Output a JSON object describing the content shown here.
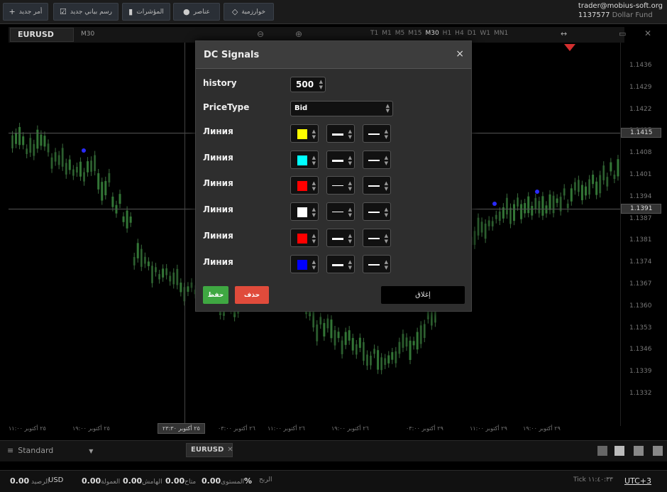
{
  "toolbar": {
    "buttons": [
      {
        "label": "أمر جديد",
        "icon": "+"
      },
      {
        "label": "رسم بياني جديد",
        "icon": "☑"
      },
      {
        "label": "المؤشرات",
        "icon": "▮"
      },
      {
        "label": "عناصر",
        "icon": "●"
      },
      {
        "label": "خوارزمية",
        "icon": "◇"
      }
    ]
  },
  "account": {
    "email": "trader@mobius-soft.org",
    "number": "1137577",
    "fund": "Dollar Fund"
  },
  "chart": {
    "symbol": "EURUSD",
    "period": "M30",
    "timeframes": [
      "T1",
      "M1",
      "M5",
      "M15",
      "M30",
      "H1",
      "H4",
      "D1",
      "W1",
      "MN1"
    ],
    "active_timeframe": "M30",
    "price_labels": [
      "1.1436",
      "1.1429",
      "1.1422",
      "1.1415",
      "1.1408",
      "1.1401",
      "1.1394",
      "1.1387",
      "1.1381",
      "1.1374",
      "1.1367",
      "1.1360",
      "1.1353",
      "1.1346",
      "1.1339",
      "1.1332"
    ],
    "price_tags": [
      "1.1415",
      "1.1391"
    ],
    "time_labels": [
      "٢٥ أكتوبر ١١:٠٠",
      "٢٥ أكتوبر ١٩:٠٠",
      "٢٥ أكتوبر ٢٣:٣٠",
      "٢٦ أكتوبر ٠٣:٠٠",
      "٢٦ أكتوبر ١١:٠٠",
      "٢٦ أكتوبر ١٩:٠٠",
      "٢٩ أكتوبر ٠٣:٠٠",
      "٢٩ أكتوبر ١١:٠٠",
      "٢٩ أكتوبر ١٩:٠٠"
    ],
    "colors": {
      "bull": "#2e7d32",
      "bear": "#1f4f22",
      "marker": "#2a2aff",
      "arrow": "#d32f2f"
    }
  },
  "dialog": {
    "title": "DC Signals",
    "close_icon": "×",
    "history_label": "history",
    "history_value": "500",
    "price_type_label": "PriceType",
    "price_type_value": "Bid",
    "lines": [
      {
        "label": "Линия",
        "color": "#ffff00",
        "thick": true
      },
      {
        "label": "Линия",
        "color": "#00ffff",
        "thick": true
      },
      {
        "label": "Линия",
        "color": "#ff0000",
        "thick": false
      },
      {
        "label": "Линия",
        "color": "#ffffff",
        "thick": false
      },
      {
        "label": "Линия",
        "color": "#ff0000",
        "thick": true
      },
      {
        "label": "Линия",
        "color": "#0000ff",
        "thick": true
      }
    ],
    "save_label": "حفظ",
    "delete_label": "حذف",
    "close_label": "إغلاق"
  },
  "bottom": {
    "layout": "Standard",
    "tab": "EURUSD"
  },
  "status": {
    "balance_value": "0.00",
    "currency": "USD",
    "equity_value": "0.00",
    "margin_value": "0.00",
    "free_value": "0.00",
    "level_value": "0.00",
    "percent": "%",
    "tick_label": "Tick",
    "time": "١١:٤٠:٣٣",
    "timezone": "UTC+3",
    "labels": {
      "balance": "الرصيد",
      "equity": "العمولة",
      "margin": "الهامش",
      "free": "متاح",
      "level": "المستوى",
      "profit": "الربح"
    }
  }
}
